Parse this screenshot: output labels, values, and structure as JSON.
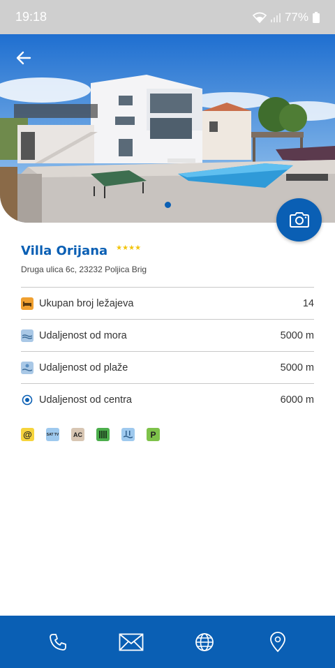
{
  "status": {
    "time": "19:18",
    "battery": "77%"
  },
  "hero": {
    "active_page": 1,
    "page_count": 1
  },
  "villa": {
    "name": "Villa Orijana",
    "stars": "★★★★",
    "address": "Druga ulica 6c, 23232 Poljica Brig"
  },
  "info": [
    {
      "icon": "bed-icon",
      "label": "Ukupan broj ležajeva",
      "value": "14"
    },
    {
      "icon": "sea-icon",
      "label": "Udaljenost od mora",
      "value": "5000 m"
    },
    {
      "icon": "beach-icon",
      "label": "Udaljenost od plaže",
      "value": "5000 m"
    },
    {
      "icon": "center-target-icon",
      "label": "Udaljenost od centra",
      "value": "6000 m"
    }
  ],
  "amenities": [
    {
      "icon": "internet-icon",
      "text": "@",
      "color": "#f6d43c"
    },
    {
      "icon": "sat-tv-icon",
      "text": "SAT TV",
      "color": "#9ec9ee"
    },
    {
      "icon": "air-conditioning-icon",
      "text": "AC",
      "color": "#d8c6b3"
    },
    {
      "icon": "grill-icon",
      "text": "",
      "color": "#4cae4c"
    },
    {
      "icon": "pool-icon",
      "text": "",
      "color": "#9ec9ee"
    },
    {
      "icon": "parking-icon",
      "text": "P",
      "color": "#7ec24a"
    }
  ],
  "colors": {
    "brand": "#0a5fb4",
    "star": "#f2c40b"
  },
  "nav": [
    "phone-icon",
    "mail-icon",
    "globe-icon",
    "location-pin-icon"
  ]
}
